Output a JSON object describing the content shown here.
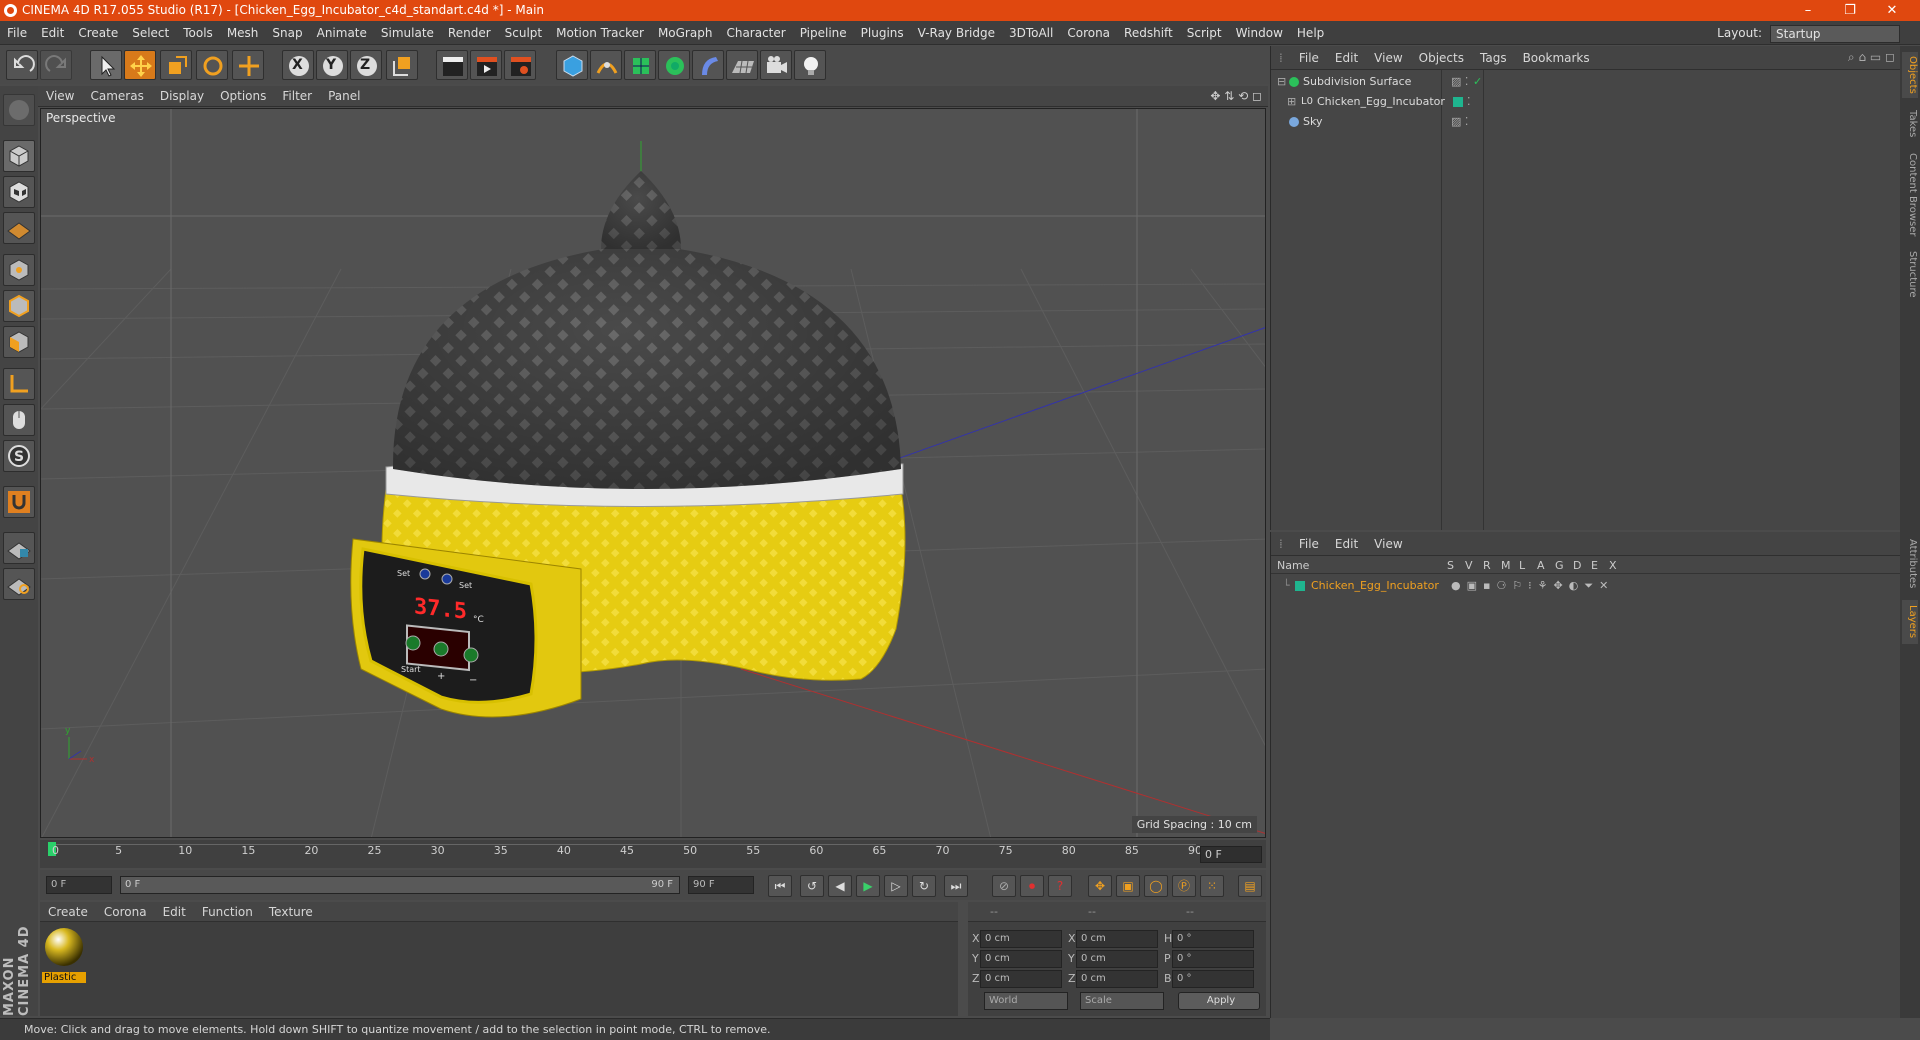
{
  "window": {
    "title": "CINEMA 4D R17.055 Studio (R17) - [Chicken_Egg_Incubator_c4d_standart.c4d *] - Main",
    "minimize": "–",
    "maximize": "❐",
    "close": "✕"
  },
  "menubar": [
    "File",
    "Edit",
    "Create",
    "Select",
    "Tools",
    "Mesh",
    "Snap",
    "Animate",
    "Simulate",
    "Render",
    "Sculpt",
    "Motion Tracker",
    "MoGraph",
    "Character",
    "Pipeline",
    "Plugins",
    "V-Ray Bridge",
    "3DToAll",
    "Corona",
    "Redshift",
    "Script",
    "Window",
    "Help"
  ],
  "layout": {
    "label": "Layout:",
    "value": "Startup"
  },
  "toolbar": {
    "axis_x": "X",
    "axis_y": "Y",
    "axis_z": "Z"
  },
  "viewport": {
    "menu": [
      "View",
      "Cameras",
      "Display",
      "Options",
      "Filter",
      "Panel"
    ],
    "label": "Perspective",
    "grid_spacing": "Grid Spacing : 10 cm",
    "axis_colors": {
      "x": "#b03030",
      "y": "#2ea82e",
      "z": "#3333aa"
    },
    "model": {
      "display_value": "37.5",
      "unit": "°C",
      "labels": [
        "Set",
        "Set",
        "Start",
        "+",
        "−"
      ]
    }
  },
  "timeline": {
    "ticks": [
      "0",
      "5",
      "10",
      "15",
      "20",
      "25",
      "30",
      "35",
      "40",
      "45",
      "50",
      "55",
      "60",
      "65",
      "70",
      "75",
      "80",
      "85",
      "90"
    ],
    "current_frame": "0 F",
    "start_field": "0 F",
    "range_start": "0 F",
    "range_end": "90 F",
    "end_field": "90 F"
  },
  "material_manager": {
    "menu": [
      "Create",
      "Corona",
      "Edit",
      "Function",
      "Texture"
    ],
    "materials": [
      {
        "name": "Plastic"
      }
    ]
  },
  "coordinates": {
    "header": [
      "--",
      "--",
      "--"
    ],
    "rows": [
      {
        "a": "X",
        "av": "0 cm",
        "b": "X",
        "bv": "0 cm",
        "c": "H",
        "cv": "0 °"
      },
      {
        "a": "Y",
        "av": "0 cm",
        "b": "Y",
        "bv": "0 cm",
        "c": "P",
        "cv": "0 °"
      },
      {
        "a": "Z",
        "av": "0 cm",
        "b": "Z",
        "bv": "0 cm",
        "c": "B",
        "cv": "0 °"
      }
    ],
    "mode1": "World",
    "mode2": "Scale",
    "apply": "Apply"
  },
  "brand": "MAXON CINEMA 4D",
  "status": "Move: Click and drag to move elements. Hold down SHIFT to quantize movement / add to the selection in point mode, CTRL to remove.",
  "object_manager": {
    "menu": [
      "File",
      "Edit",
      "View",
      "Objects",
      "Tags",
      "Bookmarks"
    ],
    "objects": [
      {
        "name": "Subdivision Surface"
      },
      {
        "name": "Chicken_Egg_Incubator"
      },
      {
        "name": "Sky"
      }
    ]
  },
  "layer_manager": {
    "menu": [
      "File",
      "Edit",
      "View"
    ],
    "columns": [
      "Name",
      "S",
      "V",
      "R",
      "M",
      "L",
      "A",
      "G",
      "D",
      "E",
      "X"
    ],
    "layers": [
      {
        "name": "Chicken_Egg_Incubator",
        "color": "#1fb58f"
      }
    ]
  },
  "right_tabs": [
    "Objects",
    "Takes",
    "Content Browser",
    "Structure",
    "Attributes",
    "Layers"
  ]
}
